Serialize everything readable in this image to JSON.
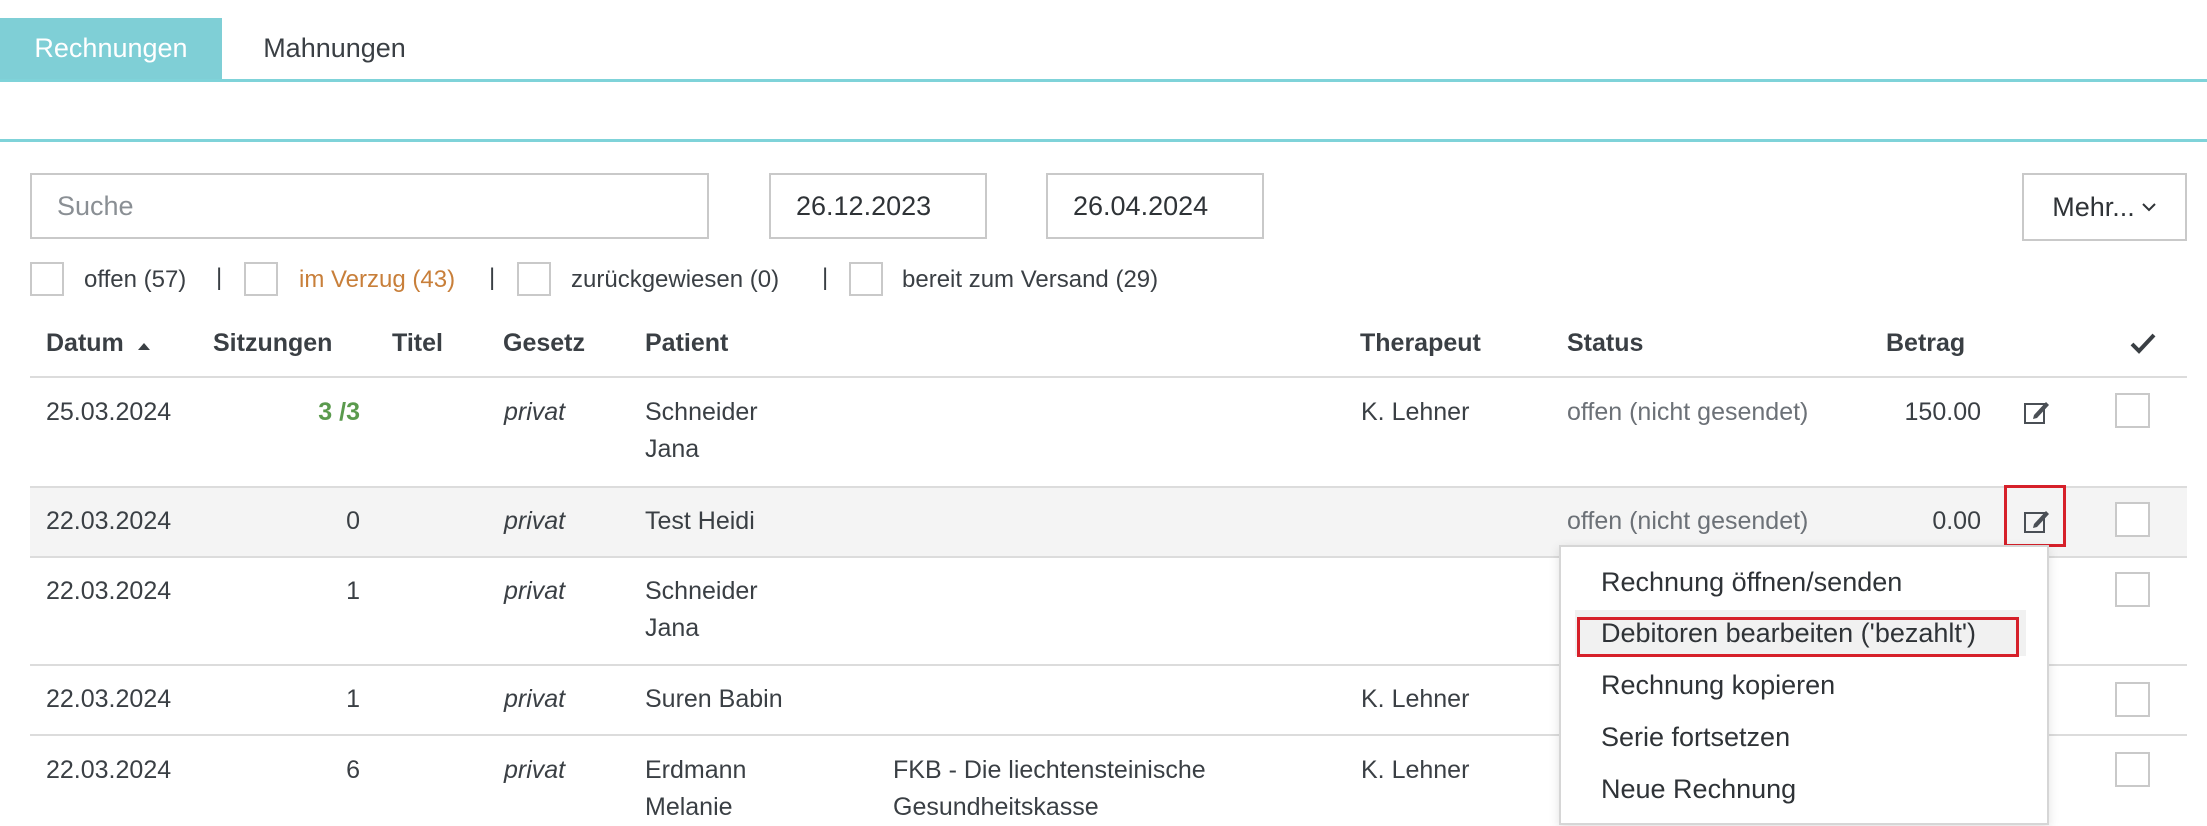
{
  "tabs": [
    {
      "label": "Rechnungen",
      "active": true
    },
    {
      "label": "Mahnungen",
      "active": false
    }
  ],
  "toolbar": {
    "search_placeholder": "Suche",
    "date_from": "26.12.2023",
    "date_to": "26.04.2024",
    "more_label": "Mehr..."
  },
  "filters": [
    {
      "label": "offen (57)"
    },
    {
      "label": "im Verzug (43)",
      "color": "#c87f3a"
    },
    {
      "label": "zurückgewiesen (0)"
    },
    {
      "label": "bereit zum Versand (29)"
    }
  ],
  "filter_separator": "|",
  "table": {
    "headers": {
      "datum": "Datum",
      "sitzungen": "Sitzungen",
      "titel": "Titel",
      "gesetz": "Gesetz",
      "patient": "Patient",
      "therapeut": "Therapeut",
      "status": "Status",
      "betrag": "Betrag"
    },
    "rows": [
      {
        "datum": "25.03.2024",
        "sitzungen": "3 /3",
        "gesetz": "privat",
        "patient_line1": "Schneider",
        "patient_line2": "Jana",
        "kasse_line1": "",
        "kasse_line2": "",
        "therapeut": "K. Lehner",
        "status": "offen (nicht gesendet)",
        "betrag": "150.00"
      },
      {
        "datum": "22.03.2024",
        "sitzungen": "0",
        "gesetz": "privat",
        "patient_line1": "Test Heidi",
        "patient_line2": "",
        "kasse_line1": "",
        "kasse_line2": "",
        "therapeut": "",
        "status": "offen (nicht gesendet)",
        "betrag": "0.00"
      },
      {
        "datum": "22.03.2024",
        "sitzungen": "1",
        "gesetz": "privat",
        "patient_line1": "Schneider",
        "patient_line2": "Jana",
        "kasse_line1": "",
        "kasse_line2": "",
        "therapeut": "",
        "status": "",
        "betrag": ""
      },
      {
        "datum": "22.03.2024",
        "sitzungen": "1",
        "gesetz": "privat",
        "patient_line1": "Suren Babin",
        "patient_line2": "",
        "kasse_line1": "",
        "kasse_line2": "",
        "therapeut": "K. Lehner",
        "status": "",
        "betrag": ""
      },
      {
        "datum": "22.03.2024",
        "sitzungen": "6",
        "gesetz": "privat",
        "patient_line1": "Erdmann",
        "patient_line2": "Melanie",
        "kasse_line1": "FKB - Die liechtensteinische",
        "kasse_line2": "Gesundheitskasse",
        "therapeut": "K. Lehner",
        "status": "",
        "betrag": ""
      }
    ]
  },
  "context_menu": {
    "items": [
      {
        "label": "Rechnung öffnen/senden"
      },
      {
        "label": "Debitoren bearbeiten ('bezahlt')",
        "highlighted": true
      },
      {
        "label": "Rechnung kopieren"
      },
      {
        "label": "Serie fortsetzen"
      },
      {
        "label": "Neue Rechnung"
      }
    ]
  },
  "colors": {
    "accent": "#7fcfd6",
    "highlight_red": "#d6202a",
    "session_green": "#5a9a4d"
  },
  "icons": [
    "chevron-down-icon",
    "sort-asc-icon",
    "checkmark-icon",
    "edit-icon"
  ]
}
